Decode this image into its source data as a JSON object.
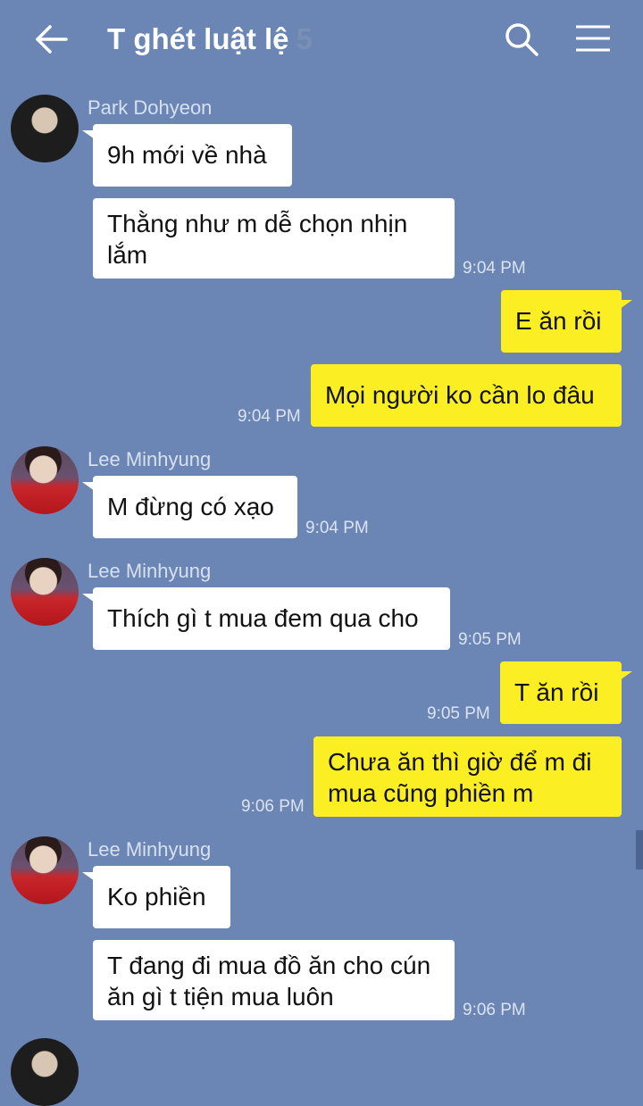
{
  "header": {
    "title": "T ghét luật lệ",
    "member_count": "5",
    "back_icon": "arrow-left-icon",
    "search_icon": "search-icon",
    "menu_icon": "hamburger-menu-icon"
  },
  "colors": {
    "background": "#6b86b4",
    "incoming_bubble": "#ffffff",
    "outgoing_bubble": "#fbef24"
  },
  "messages": [
    {
      "sender": "Park Dohyeon",
      "text": "9h mới về nhà"
    },
    {
      "text": "Thằng như m dễ chọn nhịn lắm",
      "time": "9:04 PM"
    },
    {
      "text": "E ăn rồi"
    },
    {
      "text": "Mọi người ko cần lo đâu",
      "time": "9:04 PM"
    },
    {
      "sender": "Lee Minhyung",
      "text": "M đừng có xạo",
      "time": "9:04 PM"
    },
    {
      "sender": "Lee Minhyung",
      "text": "Thích gì t mua đem qua cho",
      "time": "9:05 PM"
    },
    {
      "text": "T ăn rồi",
      "time": "9:05 PM"
    },
    {
      "text": "Chưa ăn thì giờ để m đi mua cũng phiền m",
      "time": "9:06 PM"
    },
    {
      "sender": "Lee Minhyung",
      "text": "Ko phiền"
    },
    {
      "text": "T đang đi mua đồ ăn cho cún ăn gì t tiện mua luôn",
      "time": "9:06 PM"
    }
  ]
}
